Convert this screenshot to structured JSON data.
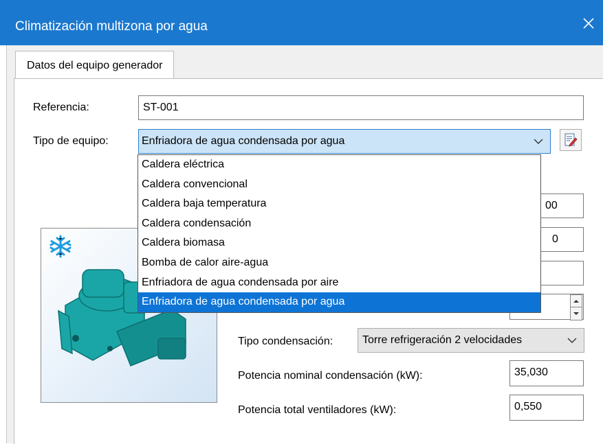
{
  "window": {
    "title": "Climatización multizona por agua"
  },
  "tabs": [
    {
      "label": "Datos del equipo generador"
    }
  ],
  "form": {
    "referencia_label": "Referencia:",
    "referencia_value": "ST-001",
    "tipo_equipo_label": "Tipo de equipo:",
    "tipo_equipo_value": "Enfriadora de agua condensada por agua",
    "tipo_equipo_options": [
      "Caldera eléctrica",
      "Caldera convencional",
      "Caldera baja temperatura",
      "Caldera condensación",
      "Caldera biomasa",
      "Bomba de calor aire-agua",
      "Enfriadora de agua condensada por aire",
      "Enfriadora de agua condensada por agua"
    ],
    "selected_option_index": 7,
    "hidden_values": [
      "00",
      "0"
    ],
    "tipo_condensacion_label": "Tipo condensación:",
    "tipo_condensacion_value": "Torre refrigeración 2 velocidades",
    "potencia_condensacion_label": "Potencia nominal condensación (kW):",
    "potencia_condensacion_value": "35,030",
    "potencia_ventiladores_label": "Potencia total ventiladores (kW):",
    "potencia_ventiladores_value": "0,550"
  },
  "icons": {
    "close": "close-icon",
    "chevron": "chevron-down-icon",
    "edit": "edit-document-icon",
    "cooling": "snowflake-icon",
    "spin_up": "spin-up-icon",
    "spin_down": "spin-down-icon"
  },
  "colors": {
    "titlebar": "#1b78cf",
    "selection": "#0d74d6",
    "combo_focus": "#cce4f7",
    "equipment": "#1aa6a6"
  }
}
